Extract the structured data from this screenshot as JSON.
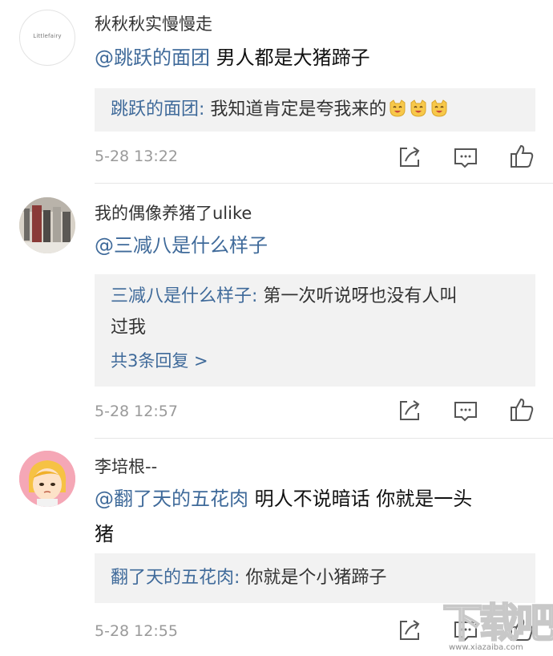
{
  "comments": [
    {
      "avatar_label": "Littlefairy",
      "username": "秋秋秋实慢慢走",
      "mention": "@跳跃的面团",
      "text": "男人都是大猪蹄子",
      "reply_user": "跳跃的面团:",
      "reply_text": "我知道肯定是夸我来的",
      "reply_emojis": [
        "laughing-cat-emoji",
        "laughing-cat-emoji",
        "laughing-cat-emoji"
      ],
      "more_replies": "",
      "time": "5-28 13:22"
    },
    {
      "avatar_label": "",
      "username": "我的偶像养猪了ulike",
      "mention": "@三减八是什么样子",
      "text": "",
      "reply_user": "三减八是什么样子:",
      "reply_text_line1": "第一次听说呀也没有人叫",
      "reply_text_line2": "过我",
      "more_replies": "共3条回复 >",
      "time": "5-28 12:57"
    },
    {
      "avatar_label": "",
      "username": "李培根--",
      "mention": "@翻了天的五花肉",
      "text_line1": "明人不说暗话 你就是一头",
      "text_line2": "猪",
      "reply_user": "翻了天的五花肉:",
      "reply_text": "你就是个小猪蹄子",
      "more_replies": "",
      "time": "5-28 12:55"
    }
  ],
  "icons": {
    "share": "share-icon",
    "comment": "comment-icon",
    "like": "like-icon"
  },
  "watermark": {
    "text": "下载吧",
    "url": "www.xiazaiba.com"
  },
  "colors": {
    "link": "#3f6a9a",
    "meta": "#9a9a9a",
    "quote_bg": "#f2f2f2"
  }
}
